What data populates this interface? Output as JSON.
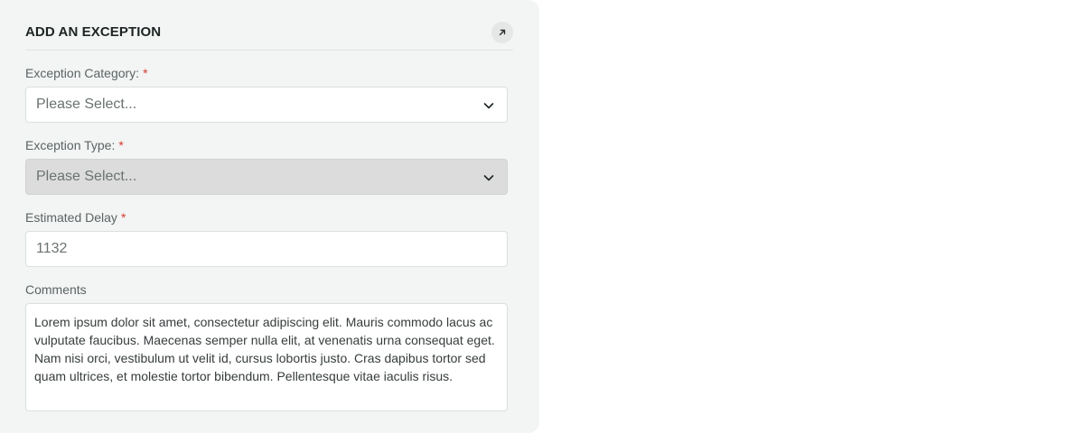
{
  "panel": {
    "title": "ADD AN EXCEPTION",
    "expand_icon": "arrow-up-right-icon"
  },
  "fields": {
    "category": {
      "label": "Exception Category:",
      "required_mark": "*",
      "selected": "Please Select..."
    },
    "type": {
      "label": "Exception Type:",
      "required_mark": "*",
      "selected": "Please Select...",
      "disabled": true
    },
    "delay": {
      "label": "Estimated Delay",
      "required_mark": "*",
      "value": "1132"
    },
    "comments": {
      "label": "Comments",
      "value": "Lorem ipsum dolor sit amet, consectetur adipiscing elit. Mauris commodo lacus ac vulputate faucibus. Maecenas semper nulla elit, at venenatis urna consequat eget. Nam nisi orci, vestibulum ut velit id, cursus lobortis justo. Cras dapibus tortor sed quam ultrices, et molestie tortor bibendum. Pellentesque vitae iaculis risus."
    }
  },
  "colors": {
    "panel_bg": "#f3f4f4",
    "required": "#d63a2e",
    "disabled_bg": "#dcdcdc"
  }
}
